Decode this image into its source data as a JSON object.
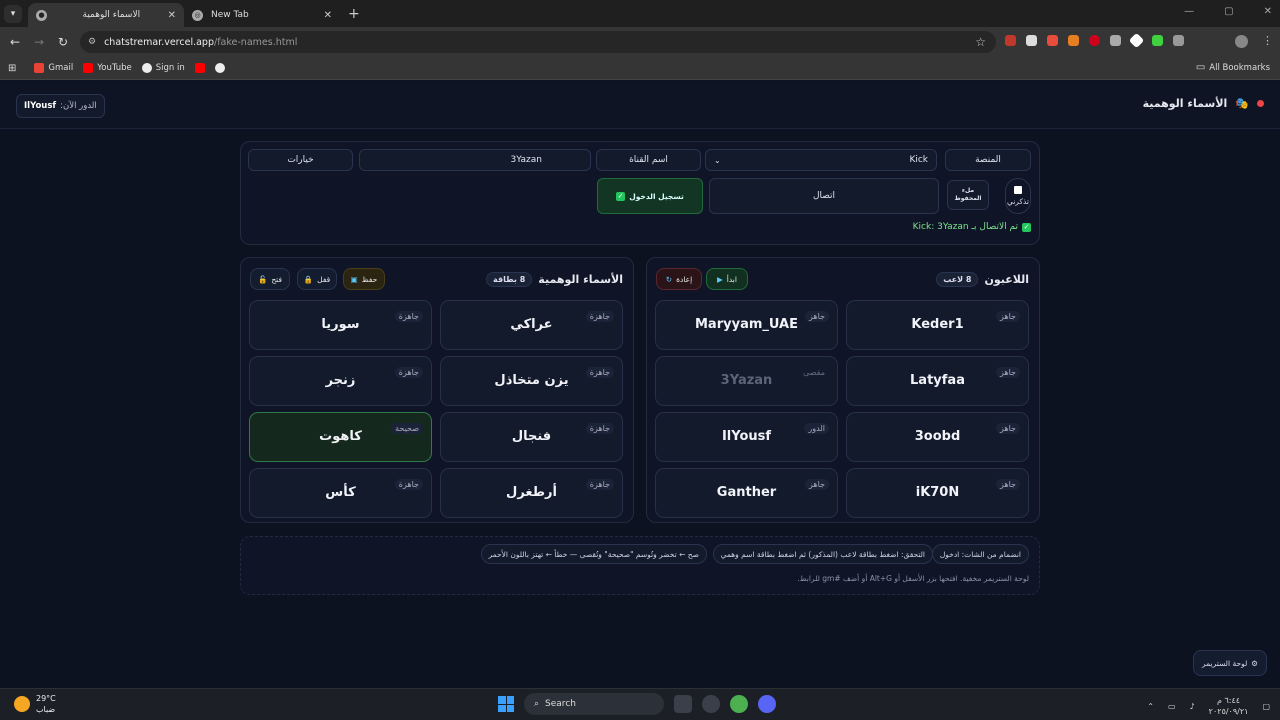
{
  "browser": {
    "tabs": [
      {
        "title": "الأسماء الوهمية",
        "active": true
      },
      {
        "title": "New Tab",
        "active": false
      }
    ],
    "url_host": "chatstremar.vercel.app",
    "url_path": "/fake-names.html",
    "bookmarks": [
      "Gmail",
      "YouTube",
      "Sign in"
    ],
    "all_bookmarks": "All Bookmarks"
  },
  "header": {
    "title": "الأسماء الوهمية",
    "turn_label": "الدور الآن:",
    "turn_player": "IlYousf"
  },
  "controls": {
    "platform_label": "المنصة",
    "platform_value": "Kick",
    "channel_label": "اسم القناة",
    "channel_value": "3Yazan",
    "options_label": "خيارات",
    "remember_label": "تذكرني",
    "pasted_label": "ملء المحفوظ",
    "connect_label": "اتصال",
    "login_label": "تسجيل الدخول",
    "status_text": "تم الاتصال بـ Kick: 3Yazan"
  },
  "players": {
    "title": "اللاعبون",
    "count": "8 لاعب",
    "start_label": "ابدأ",
    "reset_label": "إعادة",
    "cards": [
      {
        "name": "Keder1",
        "status": "جاهز"
      },
      {
        "name": "Maryyam_UAE",
        "status": "جاهز"
      },
      {
        "name": "Latyfaa",
        "status": "جاهز"
      },
      {
        "name": "3Yazan",
        "status": "مقصى"
      },
      {
        "name": "3oobd",
        "status": "جاهز"
      },
      {
        "name": "IlYousf",
        "status": "الدور"
      },
      {
        "name": "iK70N",
        "status": "جاهز"
      },
      {
        "name": "Ganther",
        "status": "جاهز"
      }
    ]
  },
  "fake_names": {
    "title": "الأسماء الوهمية",
    "count": "8 بطاقة",
    "save_label": "حفظ",
    "lock_label": "قفل",
    "open_label": "فتح",
    "cards": [
      {
        "name": "عراكي",
        "status": "جاهزة"
      },
      {
        "name": "سوريا",
        "status": "جاهزة"
      },
      {
        "name": "يزن متخاذل",
        "status": "جاهزة"
      },
      {
        "name": "زنجر",
        "status": "جاهزة"
      },
      {
        "name": "فنجال",
        "status": "جاهزة"
      },
      {
        "name": "كاهوت",
        "status": "صحيحة"
      },
      {
        "name": "أرطغرل",
        "status": "جاهزة"
      },
      {
        "name": "كأس",
        "status": "جاهزة"
      }
    ]
  },
  "hints": {
    "join": "انضمام من الشات: ادخول",
    "verify": "التحقق: اضغط بطاقة لاعب (المذكور) ثم اضغط بطاقة اسم وهمي",
    "result": "صح ← تخضر وتُوسم \"صحيحة\" وتُقصى — خطأ ← تهتز باللون الأحمر",
    "note": "لوحة الستريمر مخفية. افتحها بزر الأسفل أو Alt+G أو أضف #gm للرابط."
  },
  "streamer_panel_label": "لوحة الستريمر",
  "taskbar": {
    "temp": "29°C",
    "weather": "ضباب",
    "search": "Search",
    "time": "٦:٤٤ م",
    "date": "٢٠٢٥/٠٩/٢١"
  }
}
